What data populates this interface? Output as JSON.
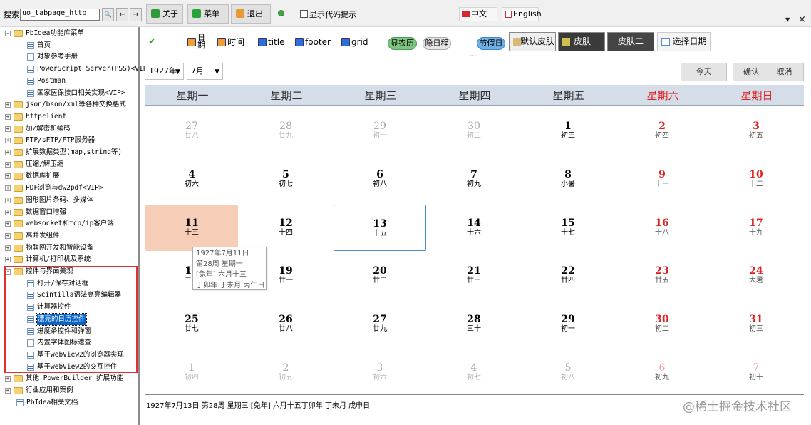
{
  "toolbar": {
    "search_label": "搜索",
    "search_value": "uo_tabpage_http",
    "search_btn": "🔍",
    "back_btn": "←",
    "fwd_btn": "→",
    "about_label": "关于",
    "menu_label": "菜单",
    "exit_label": "退出",
    "show_code_label": "显示代码提示",
    "lang_cn": "中文",
    "lang_en": "English",
    "close": "×",
    "dropdown": "▼"
  },
  "tree": {
    "items": [
      {
        "label": "PbIdea功能库菜单",
        "level": 0,
        "kind": "folder",
        "exp": "-"
      },
      {
        "label": "首页",
        "level": 1,
        "kind": "doc"
      },
      {
        "label": "对象参考手册",
        "level": 1,
        "kind": "doc"
      },
      {
        "label": "PowerScript Server(PSS)<VIP>",
        "level": 1,
        "kind": "doc"
      },
      {
        "label": "Postman",
        "level": 1,
        "kind": "doc"
      },
      {
        "label": "国家医保接口相关实现<VIP>",
        "level": 1,
        "kind": "doc"
      },
      {
        "label": "json/bson/xml等各种交换格式",
        "level": 0,
        "kind": "folder",
        "exp": "+"
      },
      {
        "label": "httpclient",
        "level": 0,
        "kind": "folder",
        "exp": "+"
      },
      {
        "label": "加/解密和编码",
        "level": 0,
        "kind": "folder",
        "exp": "+"
      },
      {
        "label": "FTP/sFTP/FTP服务器",
        "level": 0,
        "kind": "folder",
        "exp": "+"
      },
      {
        "label": "扩展数据类型(map,string等)",
        "level": 0,
        "kind": "folder",
        "exp": "+"
      },
      {
        "label": "压缩/解压缩",
        "level": 0,
        "kind": "folder",
        "exp": "+"
      },
      {
        "label": "数据库扩展",
        "level": 0,
        "kind": "folder",
        "exp": "+"
      },
      {
        "label": "PDF浏览与dw2pdf<VIP>",
        "level": 0,
        "kind": "folder",
        "exp": "+"
      },
      {
        "label": "图形图片条码、多媒体",
        "level": 0,
        "kind": "folder",
        "exp": "+"
      },
      {
        "label": "数据窗口增强",
        "level": 0,
        "kind": "folder",
        "exp": "+"
      },
      {
        "label": "websocket和tcp/ip客户端",
        "level": 0,
        "kind": "folder",
        "exp": "+"
      },
      {
        "label": "高并发组件",
        "level": 0,
        "kind": "folder",
        "exp": "+"
      },
      {
        "label": "物联网开发和智能设备",
        "level": 0,
        "kind": "folder",
        "exp": "+"
      },
      {
        "label": "计算机/打印机及系统",
        "level": 0,
        "kind": "folder",
        "exp": "+"
      },
      {
        "label": "控件与界面美观",
        "level": 0,
        "kind": "folder",
        "exp": "-"
      },
      {
        "label": "打开/保存对话框",
        "level": 1,
        "kind": "doc"
      },
      {
        "label": "Scintilla语法高亮编辑器",
        "level": 1,
        "kind": "doc"
      },
      {
        "label": "计算器控件",
        "level": 1,
        "kind": "doc"
      },
      {
        "label": "漂亮的日历控件",
        "level": 1,
        "kind": "doc",
        "selected": true
      },
      {
        "label": "进度条控件和弹窗",
        "level": 1,
        "kind": "doc"
      },
      {
        "label": "内置字体图标速查",
        "level": 1,
        "kind": "doc"
      },
      {
        "label": "基于webView2的浏览器实现",
        "level": 1,
        "kind": "doc"
      },
      {
        "label": "基于webView2的交互控件",
        "level": 1,
        "kind": "doc"
      },
      {
        "label": "其他 PowerBuilder 扩展功能",
        "level": 0,
        "kind": "folder",
        "exp": "+"
      },
      {
        "label": "行业应用和案例",
        "level": 0,
        "kind": "folder",
        "exp": "+"
      },
      {
        "label": "PbIdea相关文档",
        "level": 0,
        "kind": "doc"
      }
    ]
  },
  "options": {
    "chk_blank": "",
    "chk_day": "日\n期",
    "chk_time": "时间",
    "chk_title": "title",
    "chk_footer": "footer",
    "chk_grid": "grid",
    "pill_nongli": "显农历",
    "pill_hide": "隐日程",
    "pill_holiday": "节假日",
    "ellipsis": "...",
    "skin_default": "默认皮肤",
    "skin_one": "皮肤一",
    "skin_two": "皮肤二",
    "pick_date": "选择日期"
  },
  "controls": {
    "year": "1927年",
    "month": "7月",
    "today": "今天",
    "ok": "确认",
    "cancel": "取消"
  },
  "calendar": {
    "weekdays": [
      "星期一",
      "星期二",
      "星期三",
      "星期四",
      "星期五",
      "星期六",
      "星期日"
    ],
    "weeks": [
      [
        {
          "d": "27",
          "l": "廿八",
          "o": 1
        },
        {
          "d": "28",
          "l": "廿九",
          "o": 1
        },
        {
          "d": "29",
          "l": "初一",
          "o": 1
        },
        {
          "d": "30",
          "l": "初二",
          "o": 1
        },
        {
          "d": "1",
          "l": "初三"
        },
        {
          "d": "2",
          "l": "初四",
          "r": 1
        },
        {
          "d": "3",
          "l": "初五",
          "r": 1
        }
      ],
      [
        {
          "d": "4",
          "l": "初六"
        },
        {
          "d": "5",
          "l": "初七"
        },
        {
          "d": "6",
          "l": "初八"
        },
        {
          "d": "7",
          "l": "初九"
        },
        {
          "d": "8",
          "l": "小暑"
        },
        {
          "d": "9",
          "l": "十一",
          "r": 1
        },
        {
          "d": "10",
          "l": "十二",
          "r": 1
        }
      ],
      [
        {
          "d": "11",
          "l": "十三",
          "s": 1
        },
        {
          "d": "12",
          "l": "十四"
        },
        {
          "d": "13",
          "l": "十五",
          "t": 1
        },
        {
          "d": "14",
          "l": "十六"
        },
        {
          "d": "15",
          "l": "十七"
        },
        {
          "d": "16",
          "l": "十八",
          "r": 1
        },
        {
          "d": "17",
          "l": "十九",
          "r": 1
        }
      ],
      [
        {
          "d": "18",
          "l": "二十"
        },
        {
          "d": "19",
          "l": "廿一"
        },
        {
          "d": "20",
          "l": "廿二"
        },
        {
          "d": "21",
          "l": "廿三"
        },
        {
          "d": "22",
          "l": "廿四"
        },
        {
          "d": "23",
          "l": "廿五",
          "r": 1
        },
        {
          "d": "24",
          "l": "大暑",
          "r": 1
        }
      ],
      [
        {
          "d": "25",
          "l": "廿七"
        },
        {
          "d": "26",
          "l": "廿八"
        },
        {
          "d": "27",
          "l": "廿九"
        },
        {
          "d": "28",
          "l": "三十"
        },
        {
          "d": "29",
          "l": "初一"
        },
        {
          "d": "30",
          "l": "初二",
          "r": 1
        },
        {
          "d": "31",
          "l": "初三",
          "r": 1
        }
      ],
      [
        {
          "d": "1",
          "l": "初四",
          "o": 1
        },
        {
          "d": "2",
          "l": "初五",
          "o": 1
        },
        {
          "d": "3",
          "l": "初六",
          "o": 1
        },
        {
          "d": "4",
          "l": "初七",
          "o": 1
        },
        {
          "d": "5",
          "l": "初八",
          "o": 1
        },
        {
          "d": "6",
          "l": "初九",
          "o": 1,
          "r": 1
        },
        {
          "d": "7",
          "l": "初十",
          "o": 1,
          "r": 1
        }
      ]
    ]
  },
  "tooltip": {
    "line1": "1927年7月11日",
    "line2": "第28周 星期一",
    "line3": "[兔年] 六月十三",
    "line4": "丁卯年 丁未月 丙午日"
  },
  "footer": {
    "text": "1927年7月13日 第28周 星期三 [兔年] 六月十五丁卯年 丁未月 戊申日"
  },
  "watermark": "@稀土掘金技术社区",
  "colors": {
    "selected_cell": "#f6cdb6",
    "today_border": "#4a90c0",
    "weekend_red": "#e02020",
    "tree_selected": "#0a64c8",
    "highlight_box": "#e03030"
  }
}
